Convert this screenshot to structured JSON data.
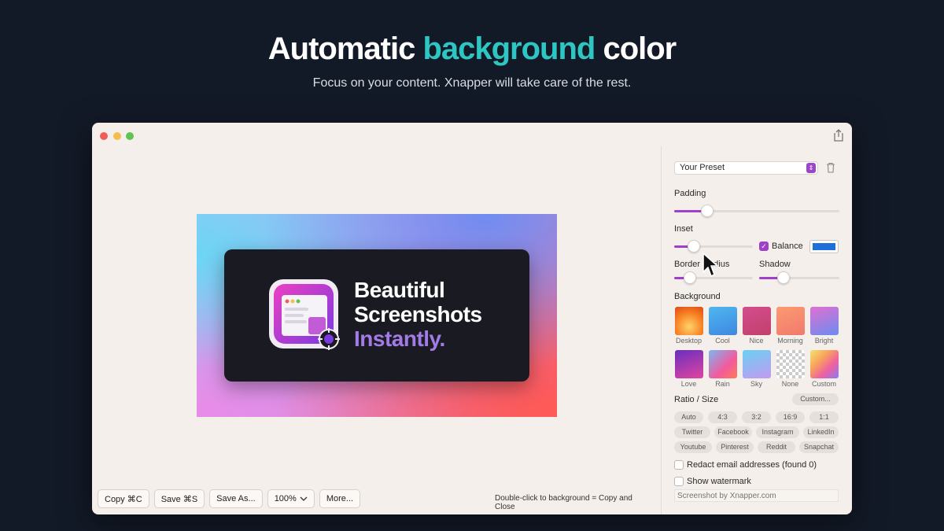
{
  "hero": {
    "title_part1": "Automatic ",
    "title_accent": "background",
    "title_part2": " color",
    "subtitle": "Focus on your content. Xnapper will take care of the rest."
  },
  "canvas": {
    "line1": "Beautiful",
    "line2": "Screenshots",
    "line3": "Instantly."
  },
  "bottom_bar": {
    "copy": "Copy ⌘C",
    "save": "Save ⌘S",
    "save_as": "Save As...",
    "zoom": "100%",
    "more": "More...",
    "hint": "Double-click to background = Copy and Close"
  },
  "sidebar": {
    "preset": "Your Preset",
    "padding_label": "Padding",
    "padding_value": 0.2,
    "inset_label": "Inset",
    "inset_value": 0.25,
    "balance_label": "Balance",
    "balance_checked": true,
    "balance_color": "#1f6fd8",
    "border_radius_label": "Border Radius",
    "border_radius_value": 0.2,
    "shadow_label": "Shadow",
    "shadow_value": 0.3,
    "background_label": "Background",
    "backgrounds": [
      {
        "label": "Desktop"
      },
      {
        "label": "Cool"
      },
      {
        "label": "Nice"
      },
      {
        "label": "Morning"
      },
      {
        "label": "Bright"
      },
      {
        "label": "Love"
      },
      {
        "label": "Rain"
      },
      {
        "label": "Sky"
      },
      {
        "label": "None"
      },
      {
        "label": "Custom"
      }
    ],
    "ratio_label": "Ratio / Size",
    "custom_button": "Custom...",
    "ratios": [
      "Auto",
      "4:3",
      "3:2",
      "16:9",
      "1:1"
    ],
    "socials_row1": [
      "Twitter",
      "Facebook",
      "Instagram",
      "LinkedIn"
    ],
    "socials_row2": [
      "Youtube",
      "Pinterest",
      "Reddit",
      "Snapchat"
    ],
    "redact_label": "Redact email addresses (found 0)",
    "watermark_label": "Show watermark",
    "watermark_placeholder": "Screenshot by Xnapper.com"
  },
  "colors": {
    "accent": "#2ec6c2",
    "purple": "#a03fc8",
    "page_bg": "#131a27"
  }
}
